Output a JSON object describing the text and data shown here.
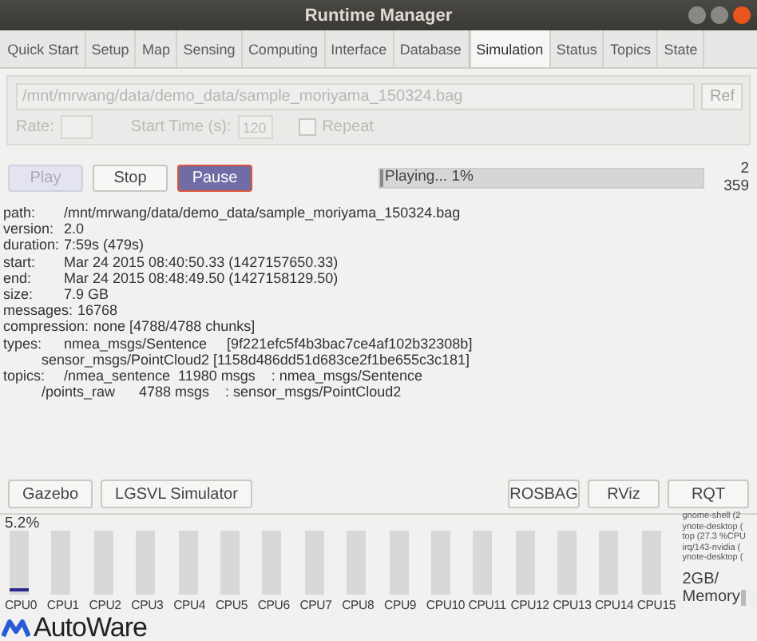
{
  "window": {
    "title": "Runtime Manager"
  },
  "tabs": [
    {
      "label": "Quick Start",
      "selected": false
    },
    {
      "label": "Setup",
      "selected": false
    },
    {
      "label": "Map",
      "selected": false
    },
    {
      "label": "Sensing",
      "selected": false
    },
    {
      "label": "Computing",
      "selected": false
    },
    {
      "label": "Interface",
      "selected": false
    },
    {
      "label": "Database",
      "selected": false
    },
    {
      "label": "Simulation",
      "selected": true
    },
    {
      "label": "Status",
      "selected": false
    },
    {
      "label": "Topics",
      "selected": false
    },
    {
      "label": "State",
      "selected": false
    }
  ],
  "bag": {
    "path": "/mnt/mrwang/data/demo_data/sample_moriyama_150324.bag",
    "ref_button": "Ref",
    "rate_label": "Rate:",
    "start_time_label": "Start Time (s):",
    "start_time": "120",
    "repeat_label": "Repeat",
    "repeat_checked": false,
    "disabled": true
  },
  "controls": [
    {
      "label": "Play",
      "disabled": true,
      "selected": false
    },
    {
      "label": "Stop",
      "disabled": false,
      "selected": false
    },
    {
      "label": "Pause",
      "disabled": false,
      "selected": true
    }
  ],
  "progress": {
    "label": "Playing... 1%",
    "level": 0.01,
    "readings": [
      "2",
      "359"
    ]
  },
  "info": [
    {
      "key": "path:",
      "value": "/mnt/mrwang/data/demo_data/sample_moriyama_150324.bag"
    },
    {
      "key": "version:",
      "value": "2.0"
    },
    {
      "key": "duration:",
      "value": "7:59s (479s)"
    },
    {
      "key": "start:",
      "value": "Mar 24 2015 08:40:50.33 (1427157650.33)"
    },
    {
      "key": "end:",
      "value": "Mar 24 2015 08:48:49.50 (1427158129.50)"
    },
    {
      "key": "size:",
      "value": "7.9 GB"
    },
    {
      "key": "messages:",
      "value": "16768"
    },
    {
      "key": "compression:",
      "value": "none [4788/4788 chunks]"
    },
    {
      "key": "types:",
      "value": "nmea_msgs/Sentence     [9f221efc5f4b3bac7ce4af102b32308b]"
    },
    {
      "value": "sensor_msgs/PointCloud2 [1158d486dd51d683ce2f1be655c3c181]"
    },
    {
      "key": "topics:",
      "value": "/nmea_sentence  11980 msgs    : nmea_msgs/Sentence"
    },
    {
      "value": "/points_raw      4788 msgs    : sensor_msgs/PointCloud2"
    }
  ],
  "left_buttons": [
    "Gazebo",
    "LGSVL Simulator"
  ],
  "right_buttons": [
    "ROSBAG",
    "RViz",
    "RQT"
  ],
  "cpu_reading": "5.2%",
  "cpus": [
    {
      "label": "CPU0",
      "level": 0.052
    },
    {
      "label": "CPU1",
      "level": 0
    },
    {
      "label": "CPU2",
      "level": 0
    },
    {
      "label": "CPU3",
      "level": 0
    },
    {
      "label": "CPU4",
      "level": 0
    },
    {
      "label": "CPU5",
      "level": 0
    },
    {
      "label": "CPU6",
      "level": 0
    },
    {
      "label": "CPU7",
      "level": 0
    },
    {
      "label": "CPU8",
      "level": 0
    },
    {
      "label": "CPU9",
      "level": 0
    },
    {
      "label": "CPU10",
      "level": 0
    },
    {
      "label": "CPU11",
      "level": 0
    },
    {
      "label": "CPU12",
      "level": 0
    },
    {
      "label": "CPU13",
      "level": 0
    },
    {
      "label": "CPU14",
      "level": 0
    },
    {
      "label": "CPU15",
      "level": 0
    }
  ],
  "processes": [
    "gnome-shell (2",
    "ynote-desktop (",
    "top (27.3 %CPU",
    "irq/143-nvidia (",
    "ynote-desktop ("
  ],
  "memory": {
    "reading": "2GB/",
    "label": "Memory",
    "level": 0.3
  },
  "logo": {
    "text": "AutoWare"
  }
}
